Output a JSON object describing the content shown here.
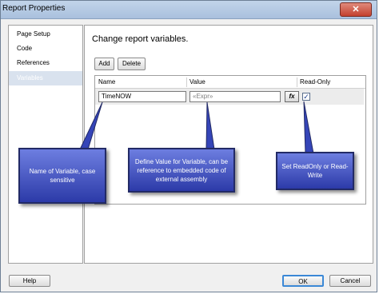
{
  "window": {
    "title": "Report Properties",
    "close_glyph": "✕"
  },
  "sidebar": {
    "items": [
      {
        "label": "Page Setup"
      },
      {
        "label": "Code"
      },
      {
        "label": "References"
      },
      {
        "label": "Variables"
      }
    ],
    "selected": "Variables"
  },
  "main": {
    "title": "Change report variables.",
    "add_label": "Add",
    "delete_label": "Delete",
    "columns": [
      "Name",
      "Value",
      "Read-Only"
    ],
    "row": {
      "name": "TimeNOW",
      "value_placeholder": "«Expr»",
      "fx_label": "fx",
      "read_only_checked": true,
      "check_glyph": "✓"
    }
  },
  "callouts": {
    "name": "Name of Variable, case sensitive",
    "value": "Define Value for Variable, can be reference to embedded code of external assembly",
    "readonly": "Set ReadOnly or Read-Write"
  },
  "footer": {
    "help_label": "Help",
    "ok_label": "OK",
    "cancel_label": "Cancel"
  },
  "colors": {
    "callout_fill": "#4a5ad0",
    "sidebar_selected": "#d9e2ee",
    "ok_focus": "#3b88d6"
  }
}
